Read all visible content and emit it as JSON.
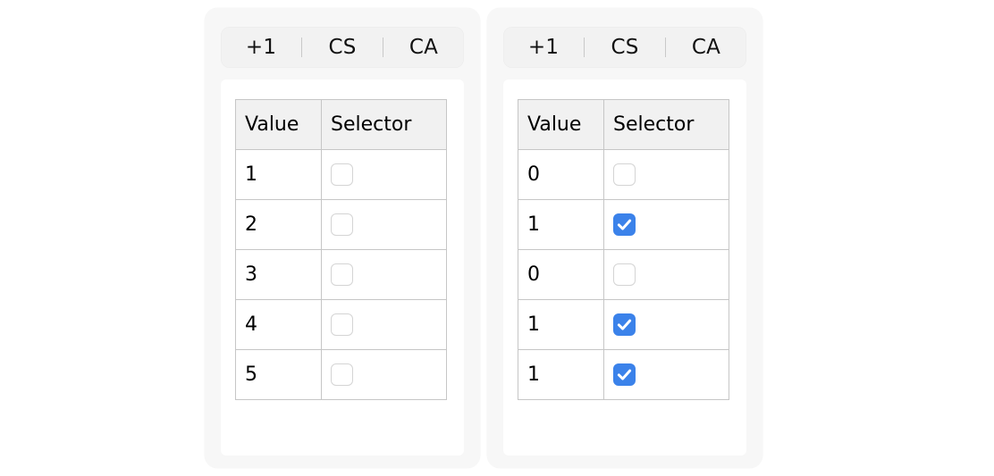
{
  "background_color": "#ffffff",
  "accent_color": "#3b82ea",
  "panels": [
    {
      "name": "left-panel",
      "segmented_control": {
        "buttons": [
          {
            "label": "+1",
            "name": "increment-button"
          },
          {
            "label": "CS",
            "name": "cs-button"
          },
          {
            "label": "CA",
            "name": "ca-button"
          }
        ]
      },
      "table": {
        "columns": [
          "Value",
          "Selector"
        ],
        "rows": [
          {
            "value": "1",
            "selected": false
          },
          {
            "value": "2",
            "selected": false
          },
          {
            "value": "3",
            "selected": false
          },
          {
            "value": "4",
            "selected": false
          },
          {
            "value": "5",
            "selected": false
          }
        ]
      }
    },
    {
      "name": "right-panel",
      "segmented_control": {
        "buttons": [
          {
            "label": "+1",
            "name": "increment-button"
          },
          {
            "label": "CS",
            "name": "cs-button"
          },
          {
            "label": "CA",
            "name": "ca-button"
          }
        ]
      },
      "table": {
        "columns": [
          "Value",
          "Selector"
        ],
        "rows": [
          {
            "value": "0",
            "selected": false
          },
          {
            "value": "1",
            "selected": true
          },
          {
            "value": "0",
            "selected": false
          },
          {
            "value": "1",
            "selected": true
          },
          {
            "value": "1",
            "selected": true
          }
        ]
      }
    }
  ],
  "icons": {
    "checkbox_checked": "checkbox-checked-icon",
    "checkbox_unchecked": "checkbox-unchecked-icon"
  }
}
